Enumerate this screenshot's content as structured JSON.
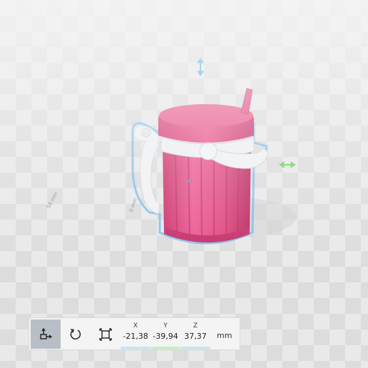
{
  "toolbar": {
    "tools": [
      {
        "icon": "move-icon",
        "active": true
      },
      {
        "icon": "rotate-icon",
        "active": false
      },
      {
        "icon": "scale-icon",
        "active": false
      }
    ],
    "coordinates": [
      {
        "axis": "X",
        "value": "-21,38",
        "color": "#c9e4f0"
      },
      {
        "axis": "Y",
        "value": "-39,94",
        "color": "#c6eec2"
      },
      {
        "axis": "Z",
        "value": "37,37",
        "color": "#c9e4f0"
      }
    ],
    "unit": "mm"
  },
  "viewport": {
    "dimension_labels": {
      "depth": "58 mm",
      "height": "0 mm"
    }
  },
  "colors": {
    "model_body": "#e5477f",
    "model_lid": "#e53b78",
    "model_handle": "#f2f3f5",
    "selection_outline": "#6fb6ec",
    "gizmo_vertical": "#2ea3e6",
    "gizmo_horizontal": "#6dd05a"
  }
}
